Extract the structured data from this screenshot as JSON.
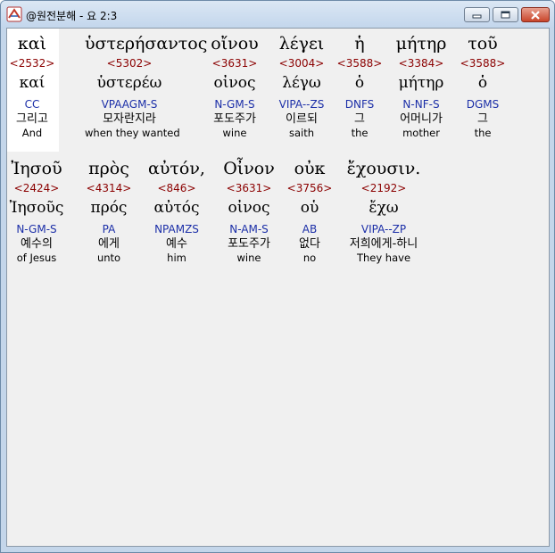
{
  "window": {
    "title": "@원전분해 - 요 2:3"
  },
  "words": [
    {
      "greek": "καὶ",
      "strong": "<2532>",
      "lemma": "καί",
      "parse": "CC",
      "korean": "그리고",
      "english": "And"
    },
    {
      "greek": "ὑστερήσαντος",
      "strong": "<5302>",
      "lemma": "ὑστερέω",
      "parse": "VPAAGM-S",
      "korean": "모자란지라",
      "english": "when they wanted"
    },
    {
      "greek": "οἴνου",
      "strong": "<3631>",
      "lemma": "οἰνος",
      "parse": "N-GM-S",
      "korean": "포도주가",
      "english": "wine"
    },
    {
      "greek": "λέγει",
      "strong": "<3004>",
      "lemma": "λέγω",
      "parse": "VIPA--ZS",
      "korean": "이르되",
      "english": "saith"
    },
    {
      "greek": "ἡ",
      "strong": "<3588>",
      "lemma": "ὁ",
      "parse": "DNFS",
      "korean": "그",
      "english": "the"
    },
    {
      "greek": "μήτηρ",
      "strong": "<3384>",
      "lemma": "μήτηρ",
      "parse": "N-NF-S",
      "korean": "어머니가",
      "english": "mother"
    },
    {
      "greek": "τοῦ",
      "strong": "<3588>",
      "lemma": "ὁ",
      "parse": "DGMS",
      "korean": "그",
      "english": "the"
    },
    {
      "greek": "Ἰησοῦ",
      "strong": "<2424>",
      "lemma": "Ἰησοῦς",
      "parse": "N-GM-S",
      "korean": "예수의",
      "english": "of Jesus"
    },
    {
      "greek": "πρὸς",
      "strong": "<4314>",
      "lemma": "πρός",
      "parse": "PA",
      "korean": "에게",
      "english": "unto"
    },
    {
      "greek": "αὐτόν,",
      "strong": "<846>",
      "lemma": "αὐτός",
      "parse": "NPAMZS",
      "korean": "예수",
      "english": "him"
    },
    {
      "greek": "Οἶνον",
      "strong": "<3631>",
      "lemma": "οἰνος",
      "parse": "N-AM-S",
      "korean": "포도주가",
      "english": "wine"
    },
    {
      "greek": "οὐκ",
      "strong": "<3756>",
      "lemma": "οὑ",
      "parse": "AB",
      "korean": "없다",
      "english": "no"
    },
    {
      "greek": "ἔχουσιν.",
      "strong": "<2192>",
      "lemma": "ἔχω",
      "parse": "VIPA--ZP",
      "korean": "저희에게-하니",
      "english": "They have"
    }
  ]
}
